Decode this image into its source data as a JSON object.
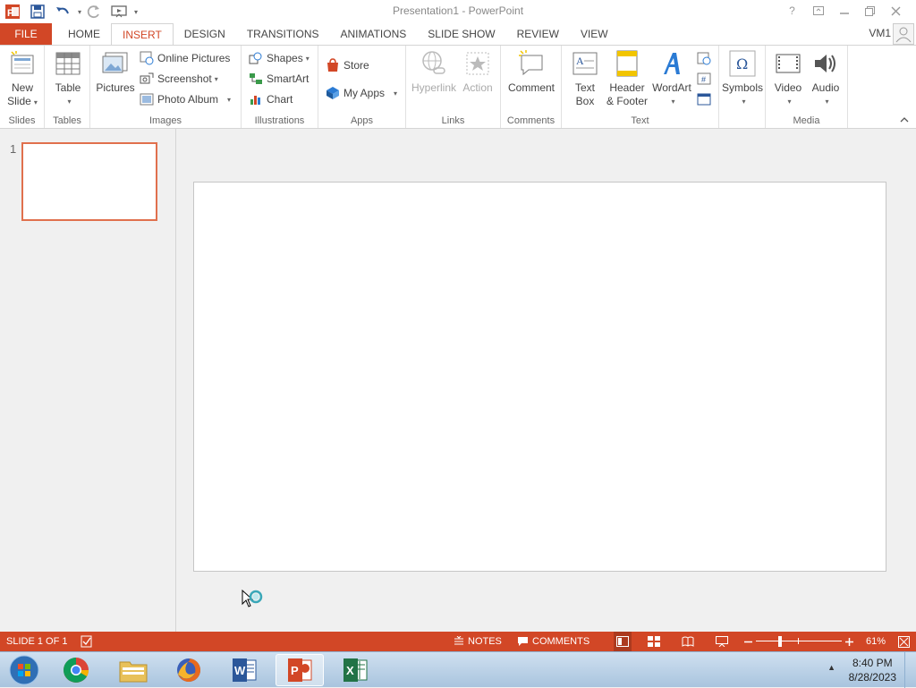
{
  "window": {
    "title": "Presentation1 - PowerPoint",
    "controls": [
      "?",
      "❐",
      "—",
      "❐",
      "✕"
    ]
  },
  "colors": {
    "accent": "#d24726",
    "thumb_border": "#e0704d"
  },
  "tabs": {
    "file": "FILE",
    "home": "HOME",
    "insert": "INSERT",
    "design": "DESIGN",
    "transitions": "TRANSITIONS",
    "animations": "ANIMATIONS",
    "slide_show": "SLIDE SHOW",
    "review": "REVIEW",
    "view": "VIEW",
    "active": "INSERT"
  },
  "user": {
    "name": "VM1"
  },
  "ribbon": {
    "slides": {
      "label": "Slides",
      "new_slide_1": "New",
      "new_slide_2": "Slide"
    },
    "tables": {
      "label": "Tables",
      "table": "Table"
    },
    "images": {
      "label": "Images",
      "pictures": "Pictures",
      "online_pictures": "Online Pictures",
      "screenshot": "Screenshot",
      "photo_album": "Photo Album"
    },
    "illustrations": {
      "label": "Illustrations",
      "shapes": "Shapes",
      "smartart": "SmartArt",
      "chart": "Chart"
    },
    "apps": {
      "label": "Apps",
      "store": "Store",
      "my_apps": "My Apps"
    },
    "links": {
      "label": "Links",
      "hyperlink": "Hyperlink",
      "action": "Action"
    },
    "comments": {
      "label": "Comments",
      "comment": "Comment"
    },
    "text": {
      "label": "Text",
      "text_box_1": "Text",
      "text_box_2": "Box",
      "header_footer_1": "Header",
      "header_footer_2": "& Footer",
      "wordart": "WordArt"
    },
    "symbols": {
      "symbols": "Symbols"
    },
    "media": {
      "label": "Media",
      "video": "Video",
      "audio": "Audio"
    }
  },
  "thumbnails": {
    "slide_number": "1"
  },
  "statusbar": {
    "slide_info": "SLIDE 1 OF 1",
    "notes": "NOTES",
    "comments": "COMMENTS",
    "zoom": "61%"
  },
  "taskbar": {
    "apps": [
      "Start",
      "Google Chrome",
      "File Explorer",
      "Firefox",
      "Word",
      "PowerPoint",
      "Excel"
    ],
    "active_app": "PowerPoint",
    "time": "8:40 PM",
    "date": "8/28/2023"
  }
}
